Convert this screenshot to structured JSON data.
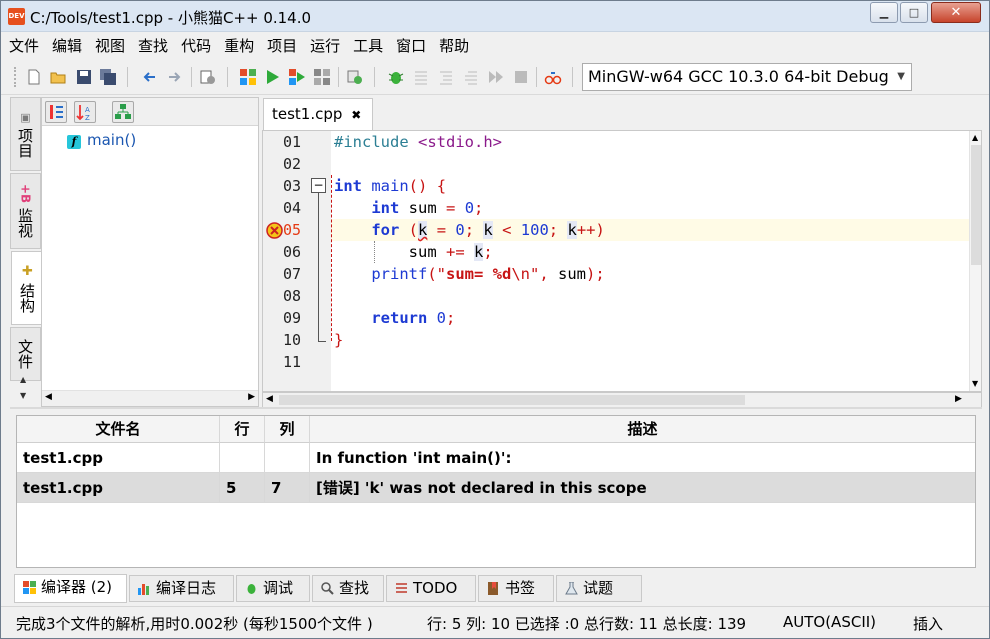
{
  "window": {
    "title": "C:/Tools/test1.cpp - 小熊猫C++ 0.14.0",
    "app_icon_text": "DEV"
  },
  "menu": [
    "文件",
    "编辑",
    "视图",
    "查找",
    "代码",
    "重构",
    "项目",
    "运行",
    "工具",
    "窗口",
    "帮助"
  ],
  "toolbar": {
    "compiler_select": "MinGW-w64 GCC 10.3.0 64-bit Debug"
  },
  "left_tabs": [
    "项目",
    "监视",
    "结构",
    "文件"
  ],
  "structure": {
    "items": [
      {
        "icon": "f",
        "label": "main()"
      }
    ]
  },
  "editor": {
    "tab_label": "test1.cpp",
    "tab_close": "✖",
    "line_numbers": [
      "01",
      "02",
      "03",
      "04",
      "05",
      "06",
      "07",
      "08",
      "09",
      "10",
      "11"
    ],
    "fold_marker": "−",
    "error_line": 5
  },
  "results": {
    "columns": [
      "文件名",
      "行",
      "列",
      "描述"
    ],
    "rows": [
      {
        "file": "test1.cpp",
        "line": "",
        "col": "",
        "desc": "In function 'int main()':"
      },
      {
        "file": "test1.cpp",
        "line": "5",
        "col": "7",
        "desc": "[错误] 'k' was not declared in this scope"
      }
    ]
  },
  "bottom_tabs": [
    "编译器 (2)",
    "编译日志",
    "调试",
    "查找",
    "TODO",
    "书签",
    "试题"
  ],
  "status": {
    "message": "完成3个文件的解析,用时0.002秒 (每秒1500个文件 )",
    "position": "行: 5 列: 10 已选择 :0 总行数: 11 总长度: 139",
    "encoding": "AUTO(ASCII)",
    "mode": "插入"
  },
  "colors": {
    "keyword": "#1d3ad3",
    "string": "#c71414",
    "error_marker": "#e53a14",
    "current_line": "#fffbe6"
  }
}
